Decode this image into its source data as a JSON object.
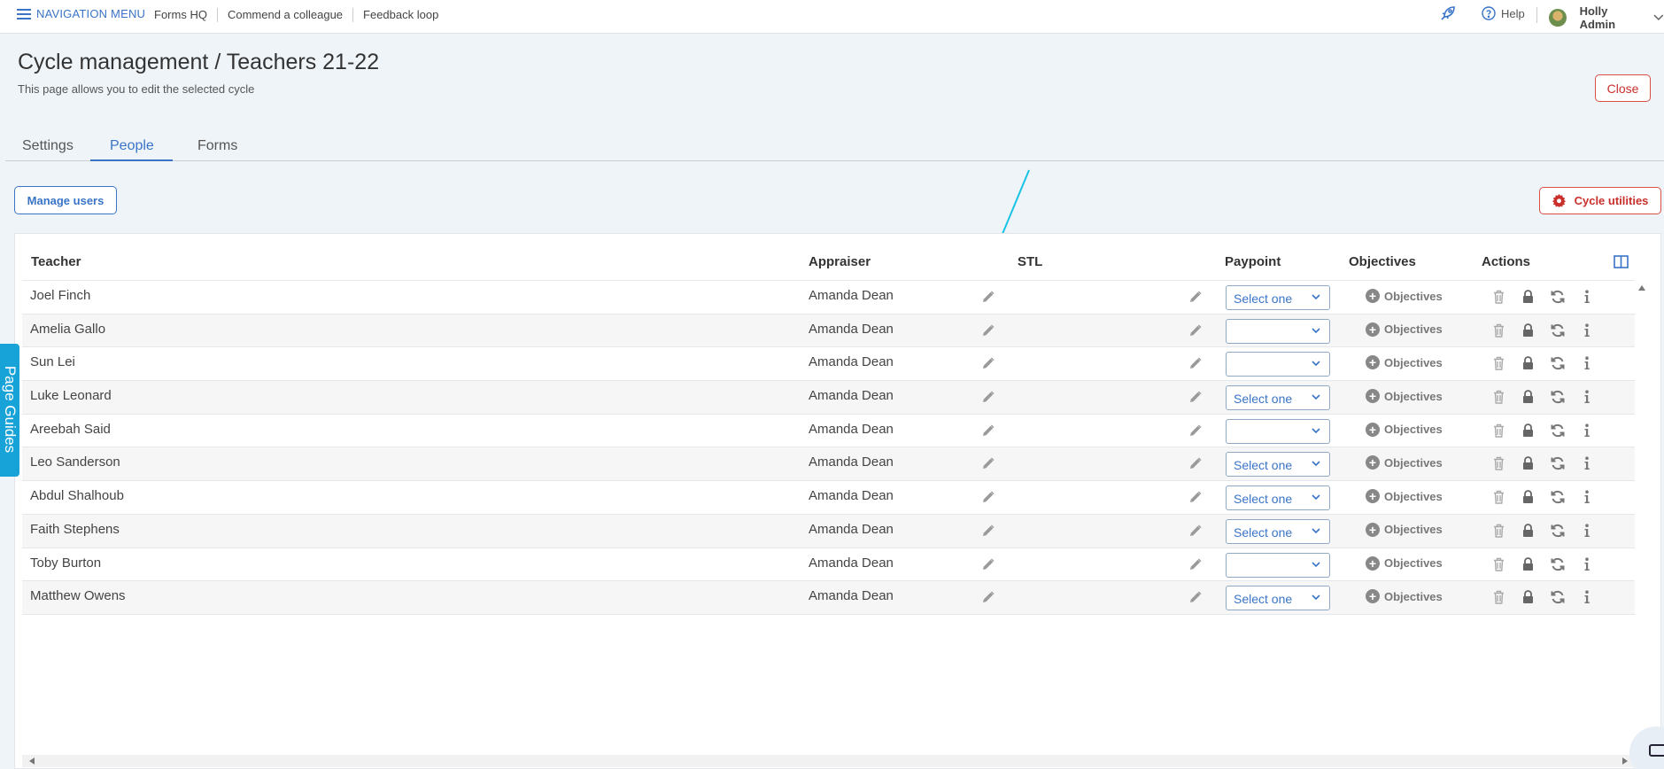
{
  "topbar": {
    "nav_menu_label": "NAVIGATION MENU",
    "links": [
      "Forms HQ",
      "Commend a colleague",
      "Feedback loop"
    ],
    "help_label": "Help",
    "user_name": "Holly Admin"
  },
  "page": {
    "title": "Cycle management / Teachers 21-22",
    "subtitle": "This page allows you to edit the selected cycle",
    "close_label": "Close"
  },
  "tabs": [
    {
      "label": "Settings",
      "active": false
    },
    {
      "label": "People",
      "active": true
    },
    {
      "label": "Forms",
      "active": false
    }
  ],
  "toolbar": {
    "manage_users_label": "Manage users",
    "cycle_utilities_label": "Cycle utilities"
  },
  "table": {
    "headers": {
      "teacher": "Teacher",
      "appraiser": "Appraiser",
      "stl": "STL",
      "paypoint": "Paypoint",
      "objectives": "Objectives",
      "actions": "Actions"
    },
    "objectives_label": "Objectives",
    "rows": [
      {
        "teacher": "Joel Finch",
        "appraiser": "Amanda Dean",
        "paypoint": "Select one"
      },
      {
        "teacher": "Amelia Gallo",
        "appraiser": "Amanda Dean",
        "paypoint": ""
      },
      {
        "teacher": "Sun Lei",
        "appraiser": "Amanda Dean",
        "paypoint": ""
      },
      {
        "teacher": "Luke Leonard",
        "appraiser": "Amanda Dean",
        "paypoint": "Select one"
      },
      {
        "teacher": "Areebah Said",
        "appraiser": "Amanda Dean",
        "paypoint": ""
      },
      {
        "teacher": "Leo Sanderson",
        "appraiser": "Amanda Dean",
        "paypoint": "Select one"
      },
      {
        "teacher": "Abdul Shalhoub",
        "appraiser": "Amanda Dean",
        "paypoint": "Select one"
      },
      {
        "teacher": "Faith Stephens",
        "appraiser": "Amanda Dean",
        "paypoint": "Select one"
      },
      {
        "teacher": "Toby Burton",
        "appraiser": "Amanda Dean",
        "paypoint": ""
      },
      {
        "teacher": "Matthew Owens",
        "appraiser": "Amanda Dean",
        "paypoint": "Select one"
      }
    ]
  },
  "page_guides_label": "Page Guides",
  "icons": {
    "menu": "hamburger-icon",
    "rocket": "rocket-icon",
    "help": "question-circle-icon",
    "cog": "gear-icon",
    "edit": "pencil-icon",
    "add": "plus-circle-icon",
    "delete": "trash-icon",
    "lock": "lock-icon",
    "sync": "sync-icon",
    "info": "info-icon",
    "columns": "columns-icon",
    "chat": "chat-icon"
  },
  "colors": {
    "primary": "#3a74c7",
    "danger": "#c9302c",
    "page_bg": "#eff4f8",
    "guides_bg": "#17a2d8",
    "annotation_arrow": "#19c3e6"
  }
}
